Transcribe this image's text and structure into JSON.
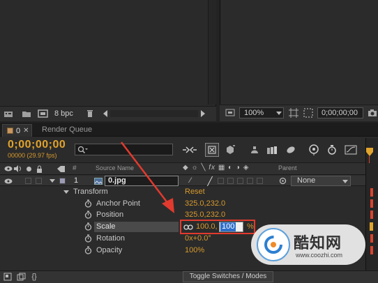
{
  "project_panel": {
    "bit_depth": "8 bpc",
    "icons": [
      "interpret-footage-icon",
      "new-folder-icon",
      "new-composition-icon",
      "trash-icon",
      "scroll-left-icon",
      "scroll-right-icon"
    ]
  },
  "comp_viewer": {
    "zoom": "100%",
    "timecode": "0;00;00;00",
    "icons": [
      "always-preview-icon",
      "zoom-dropdown-icon",
      "safe-margins-icon",
      "region-of-interest-icon",
      "snapshot-icon"
    ]
  },
  "tabs": [
    {
      "label": "0",
      "active": true
    },
    {
      "label": "Render Queue",
      "active": false
    }
  ],
  "timeline": {
    "timecode": "0;00;00;00",
    "frame_info": "00000 (29.97 fps)",
    "search_placeholder": "",
    "col_source_name": "Source Name",
    "col_parent": "Parent",
    "col_hash": "#",
    "layer": {
      "number": "1",
      "name": "0.jpg",
      "parent": "None"
    },
    "transform": {
      "label": "Transform",
      "reset": "Reset",
      "properties": [
        {
          "name": "Anchor Point",
          "value": "325.0,232.0"
        },
        {
          "name": "Position",
          "value": "325.0,232.0"
        },
        {
          "name": "Scale",
          "value_x": "100.0,",
          "value_y": "100",
          "unit": "%"
        },
        {
          "name": "Rotation",
          "value": "0x+0.0°"
        },
        {
          "name": "Opacity",
          "value": "100%"
        }
      ]
    },
    "toggle_label": "Toggle Switches / Modes"
  },
  "watermark": {
    "title": "酷知网",
    "url": "www.coozhi.com"
  },
  "colors": {
    "accent_orange": "#d89a2d",
    "highlight_red": "#e23a2e",
    "selection_blue": "#2f6fc9",
    "panel_bg": "#2b2b2b"
  }
}
